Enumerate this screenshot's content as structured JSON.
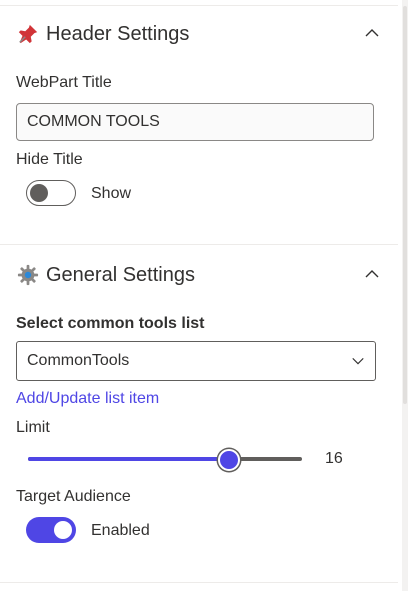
{
  "header_settings": {
    "title": "Header Settings",
    "icon": "pin-icon",
    "webpart_title_label": "WebPart Title",
    "webpart_title_value": "COMMON TOOLS",
    "hide_title_label": "Hide Title",
    "hide_title_toggle_state": "off",
    "hide_title_toggle_text": "Show"
  },
  "general_settings": {
    "title": "General Settings",
    "icon": "gear-icon",
    "list_label": "Select common tools list",
    "list_selected": "CommonTools",
    "add_update_link": "Add/Update list item",
    "limit_label": "Limit",
    "limit_value": "16",
    "limit_fraction": 0.73,
    "target_audience_label": "Target Audience",
    "target_audience_toggle_state": "on",
    "target_audience_toggle_text": "Enabled"
  },
  "colors": {
    "accent": "#4f46e5",
    "text": "#323130",
    "border": "#8a8886"
  }
}
